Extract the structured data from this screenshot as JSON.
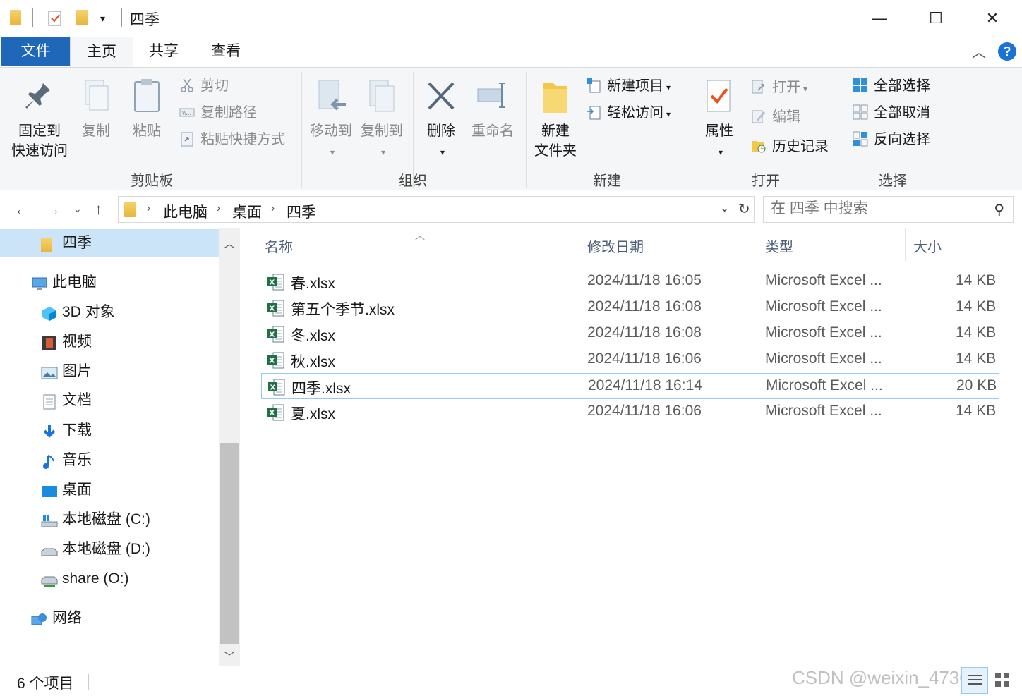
{
  "window": {
    "title": "四季",
    "minimize": "—",
    "maximize": "☐",
    "close": "✕"
  },
  "ribbon_tabs": [
    {
      "label": "文件"
    },
    {
      "label": "主页"
    },
    {
      "label": "共享"
    },
    {
      "label": "查看"
    }
  ],
  "ribbon": {
    "clipboard": {
      "pin_line1": "固定到",
      "pin_line2": "快速访问",
      "copy": "复制",
      "paste": "粘贴",
      "cut": "剪切",
      "copy_path": "复制路径",
      "paste_shortcut": "粘贴快捷方式",
      "group_label": "剪贴板"
    },
    "organize": {
      "move_to": "移动到",
      "copy_to": "复制到",
      "delete": "删除",
      "rename": "重命名",
      "group_label": "组织"
    },
    "new": {
      "new_folder_line1": "新建",
      "new_folder_line2": "文件夹",
      "new_item": "新建项目",
      "easy_access": "轻松访问",
      "group_label": "新建"
    },
    "open": {
      "properties": "属性",
      "open": "打开",
      "edit": "编辑",
      "history": "历史记录",
      "group_label": "打开"
    },
    "select": {
      "select_all": "全部选择",
      "select_none": "全部取消",
      "invert": "反向选择",
      "group_label": "选择"
    }
  },
  "address": {
    "crumbs": [
      "此电脑",
      "桌面",
      "四季"
    ]
  },
  "search": {
    "placeholder": "在 四季 中搜索"
  },
  "nav_pane": {
    "items": [
      {
        "label": "四季"
      },
      {
        "label": "此电脑"
      },
      {
        "label": "3D 对象"
      },
      {
        "label": "视频"
      },
      {
        "label": "图片"
      },
      {
        "label": "文档"
      },
      {
        "label": "下载"
      },
      {
        "label": "音乐"
      },
      {
        "label": "桌面"
      },
      {
        "label": "本地磁盘 (C:)"
      },
      {
        "label": "本地磁盘 (D:)"
      },
      {
        "label": "share (O:)"
      },
      {
        "label": "网络"
      }
    ]
  },
  "file_list": {
    "columns": [
      "名称",
      "修改日期",
      "类型",
      "大小"
    ],
    "rows": [
      {
        "name": "春.xlsx",
        "modified": "2024/11/18 16:05",
        "type": "Microsoft Excel ...",
        "size": "14 KB"
      },
      {
        "name": "第五个季节.xlsx",
        "modified": "2024/11/18 16:08",
        "type": "Microsoft Excel ...",
        "size": "14 KB"
      },
      {
        "name": "冬.xlsx",
        "modified": "2024/11/18 16:08",
        "type": "Microsoft Excel ...",
        "size": "14 KB"
      },
      {
        "name": "秋.xlsx",
        "modified": "2024/11/18 16:06",
        "type": "Microsoft Excel ...",
        "size": "14 KB"
      },
      {
        "name": "四季.xlsx",
        "modified": "2024/11/18 16:14",
        "type": "Microsoft Excel ...",
        "size": "20 KB"
      },
      {
        "name": "夏.xlsx",
        "modified": "2024/11/18 16:06",
        "type": "Microsoft Excel ...",
        "size": "14 KB"
      }
    ],
    "selected_row": "四季.xlsx"
  },
  "status": {
    "item_count": "6 个项目"
  },
  "watermark": "CSDN @weixin_4730",
  "colors": {
    "file_tab": "#1f67b8",
    "selection": "#cce4f7",
    "selection_border": "#99c9ef",
    "excel_green": "#1e7145",
    "header_text": "#4c607a"
  }
}
